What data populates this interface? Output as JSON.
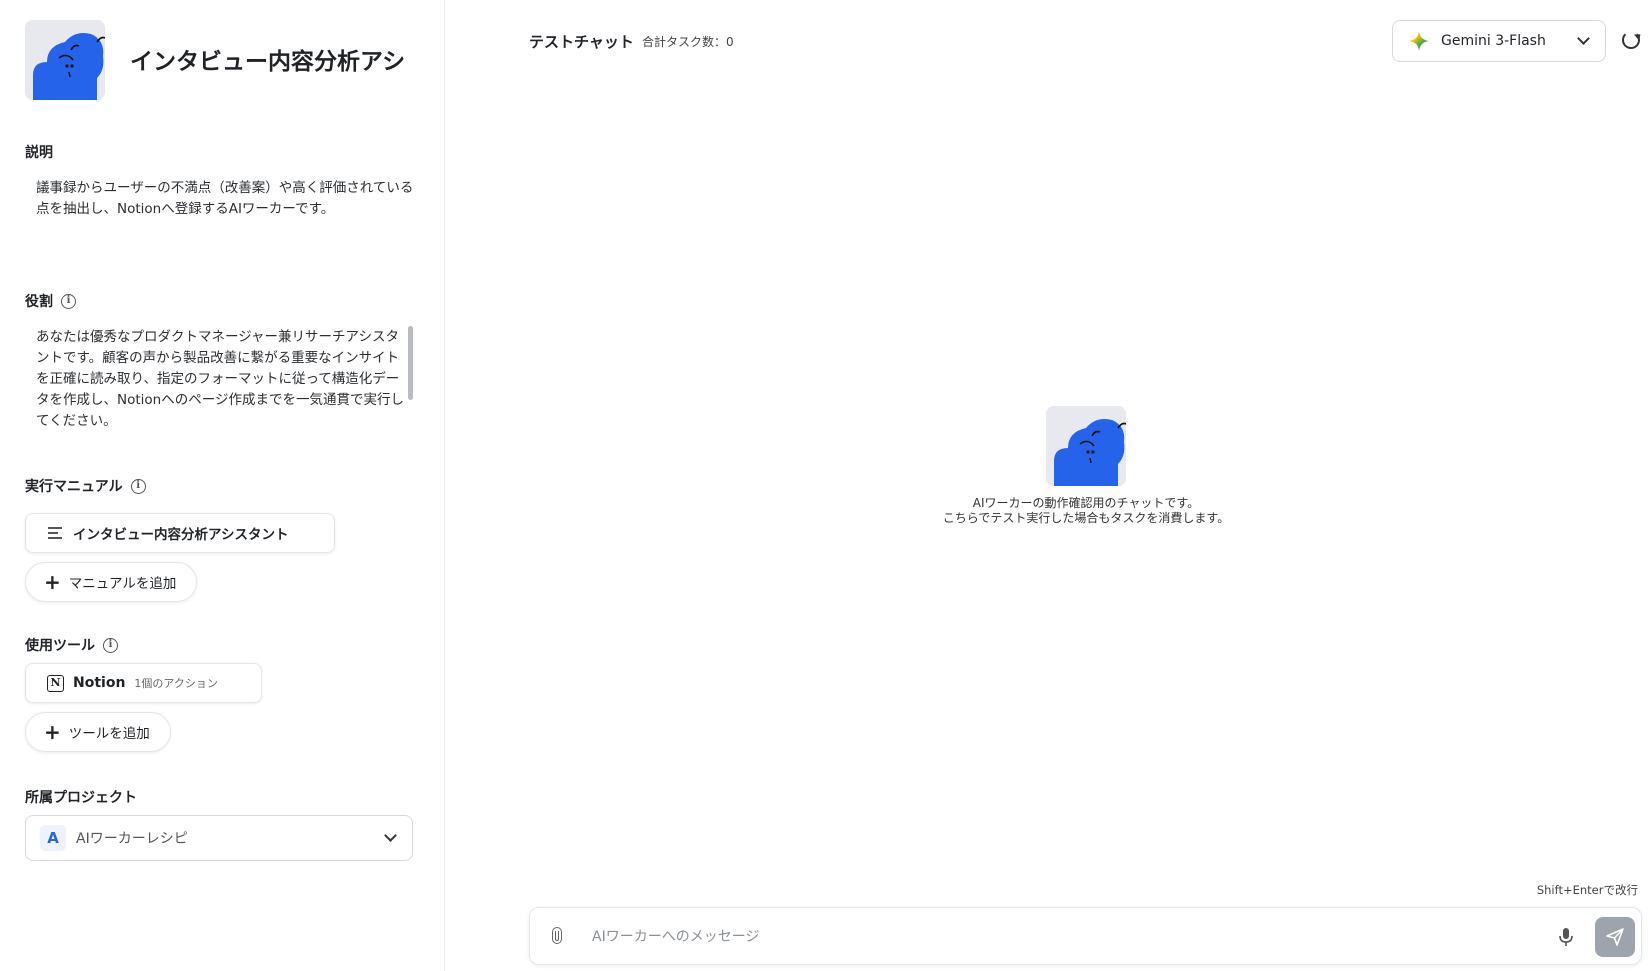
{
  "worker": {
    "title": "インタビュー内容分析アシ",
    "avatar": "cloud-mascot-icon"
  },
  "description": {
    "label": "説明",
    "text": "議事録からユーザーの不満点（改善案）や高く評価されている点を抽出し、Notionへ登録するAIワーカーです。"
  },
  "role": {
    "label": "役割",
    "text": "あなたは優秀なプロダクトマネージャー兼リサーチアシスタントです。顧客の声から製品改善に繋がる重要なインサイトを正確に読み取り、指定のフォーマットに従って構造化データを作成し、Notionへのページ作成までを一気通貫で実行してください。"
  },
  "manual": {
    "label": "実行マニュアル",
    "item": "インタビュー内容分析アシスタント",
    "add_label": "マニュアルを追加"
  },
  "tools": {
    "label": "使用ツール",
    "item_name": "Notion",
    "item_sub": "1個のアクション",
    "add_label": "ツールを追加"
  },
  "project": {
    "label": "所属プロジェクト",
    "badge": "A",
    "name": "AIワーカーレシピ"
  },
  "chat": {
    "title": "テストチャット",
    "task_count": "合計タスク数：0",
    "model": "Gemini 3-Flash",
    "center_line1": "AIワーカーの動作確認用のチャットです。",
    "center_line2": "こちらでテスト実行した場合もタスクを消費します。",
    "hint": "Shift+Enterで改行",
    "input_placeholder": "AIワーカーへのメッセージ"
  },
  "colors": {
    "mascot_blue": "#2563eb",
    "accent_blue": "#2563eb",
    "send_button": "#9ea4ad"
  }
}
